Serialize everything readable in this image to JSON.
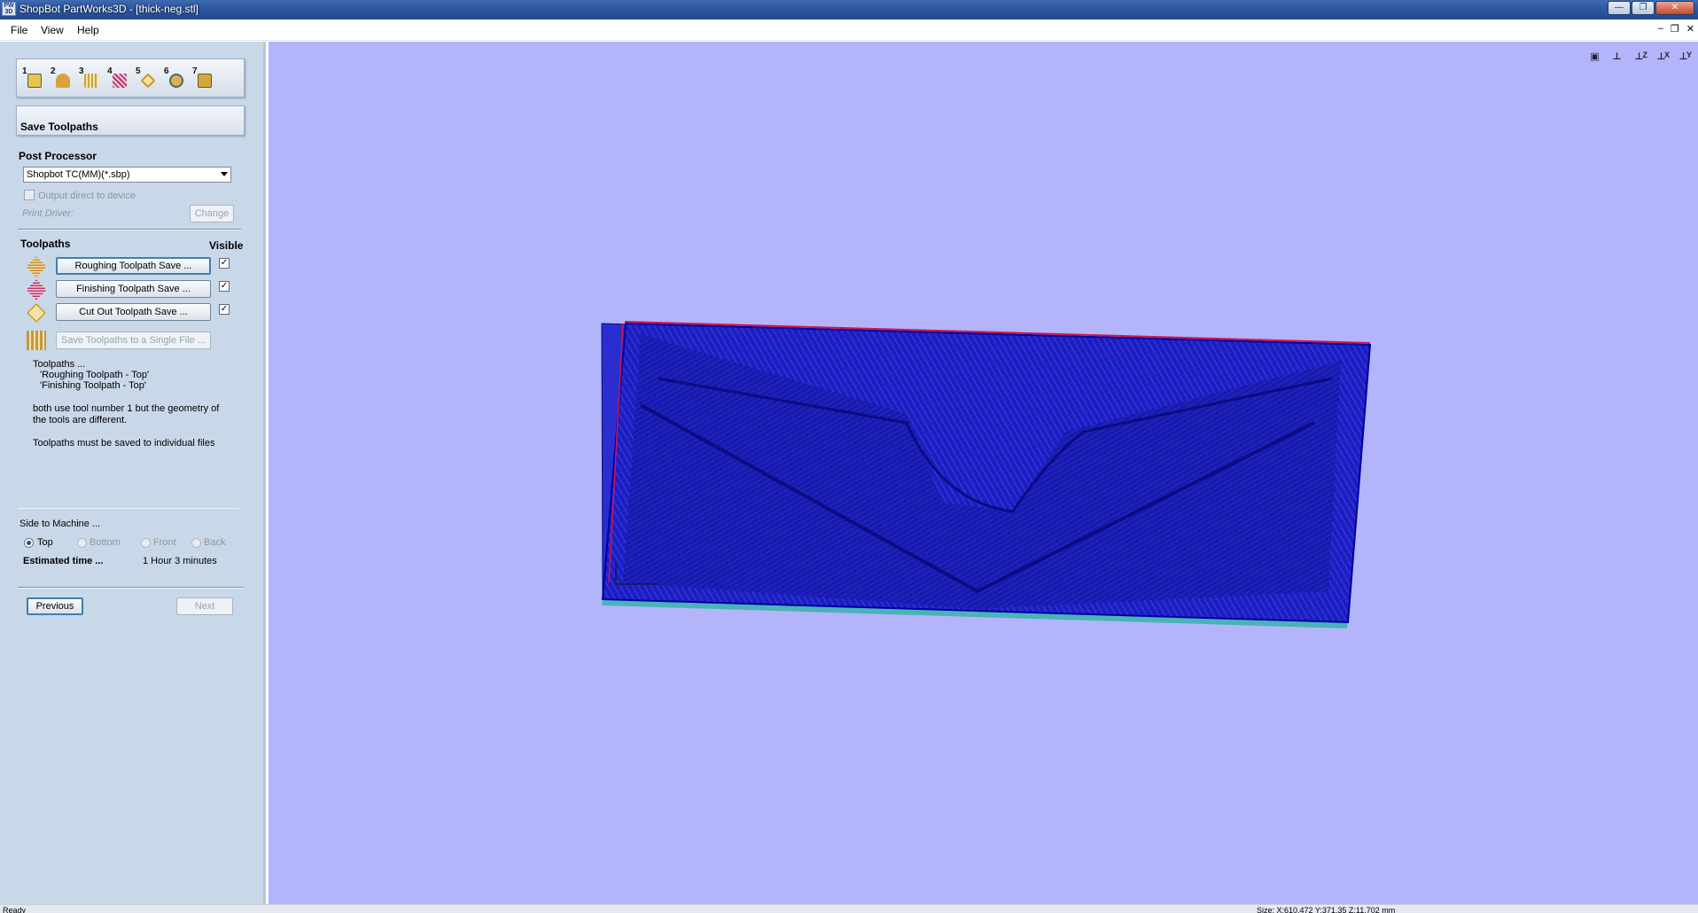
{
  "window": {
    "title": "ShopBot PartWorks3D - [thick-neg.stl]",
    "app_icon_text": "PW 3D",
    "controls": [
      "minimize",
      "restore",
      "close"
    ]
  },
  "menu": {
    "file": "File",
    "view": "View",
    "help": "Help"
  },
  "wizard": {
    "steps": [
      {
        "num": "1",
        "icon": "layers-icon"
      },
      {
        "num": "2",
        "icon": "material-icon"
      },
      {
        "num": "3",
        "icon": "roughing-icon"
      },
      {
        "num": "4",
        "icon": "finishing-icon"
      },
      {
        "num": "5",
        "icon": "cutout-icon"
      },
      {
        "num": "6",
        "icon": "preview-icon"
      },
      {
        "num": "7",
        "icon": "save-icon"
      }
    ]
  },
  "panel": {
    "title": "Save Toolpaths",
    "post_processor_label": "Post Processor",
    "post_processor_value": "Shopbot TC(MM)(*.sbp)",
    "output_direct_label": "Output direct to device",
    "print_driver_label": "Print Driver:",
    "change_button": "Change",
    "toolpaths_label": "Toolpaths",
    "visible_label": "Visible",
    "toolpaths": [
      {
        "label": "Roughing Toolpath Save ...",
        "visible": "✓",
        "icon": "roughing-toolpath-icon"
      },
      {
        "label": "Finishing Toolpath Save ...",
        "visible": "✓",
        "icon": "finishing-toolpath-icon"
      },
      {
        "label": "Cut Out Toolpath Save ...",
        "visible": "✓",
        "icon": "cutout-toolpath-icon"
      }
    ],
    "save_single_button": "Save Toolpaths to a Single File ...",
    "message": {
      "line1": "Toolpaths ...",
      "line2": "'Roughing Toolpath - Top'",
      "line3": "'Finishing Toolpath  - Top'",
      "line4": "both use  tool number  1 but the geometry of",
      "line5": "the tools are different.",
      "line6": "Toolpaths must be saved to individual files"
    },
    "side_label": "Side to Machine ...",
    "sides": [
      "Top",
      "Bottom",
      "Front",
      "Back"
    ],
    "selected_side": "Top",
    "estimated_label": "Estimated time ...",
    "estimated_value": "1 Hour 3 minutes",
    "previous_button": "Previous",
    "next_button": "Next"
  },
  "viewport": {
    "background": "#b3b4f9",
    "toolpath_color": "#1a1ab8",
    "view_buttons": [
      {
        "icon": "zoom-extents-icon",
        "tag": ""
      },
      {
        "icon": "iso-view-icon",
        "tag": ""
      },
      {
        "icon": "top-view-icon",
        "tag": "Z"
      },
      {
        "icon": "front-view-icon",
        "tag": "X"
      },
      {
        "icon": "side-view-icon",
        "tag": "Y"
      }
    ]
  },
  "status": {
    "left": "Ready",
    "right": "Size: X:610.472 Y:371.35 Z:11.702 mm"
  }
}
